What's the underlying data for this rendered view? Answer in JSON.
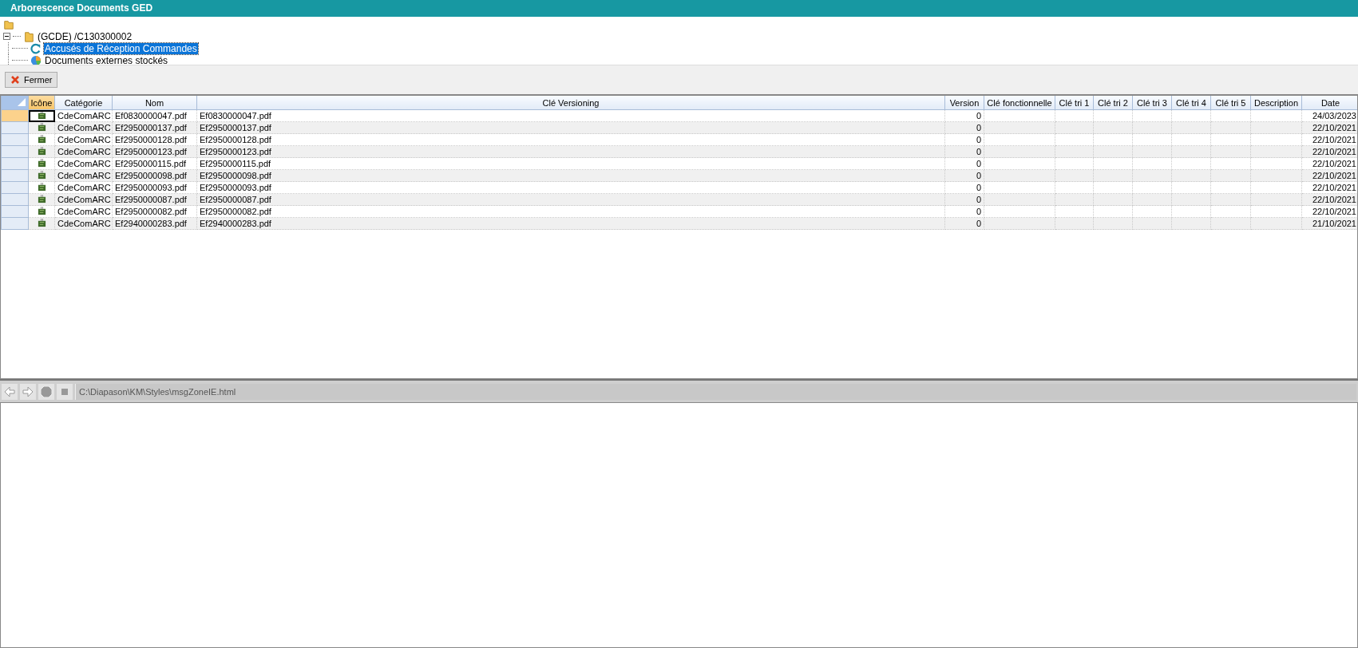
{
  "window": {
    "title": "Arborescence Documents GED"
  },
  "tree": {
    "root": {
      "children": [
        {
          "label": "(GCDE) /C130300002",
          "expanded": true,
          "children": [
            {
              "label": "Accusés de Réception Commandes",
              "kind": "refresh",
              "selected": true
            },
            {
              "label": "Documents externes stockés",
              "kind": "chart",
              "selected": false
            }
          ]
        }
      ]
    }
  },
  "toolbar": {
    "close_button": "Fermer"
  },
  "table": {
    "columns": [
      {
        "label": "Icône",
        "selected": true
      },
      {
        "label": "Catégorie",
        "selected": false
      },
      {
        "label": "Nom",
        "selected": false
      },
      {
        "label": "Clé Versioning",
        "selected": false
      },
      {
        "label": "Version",
        "selected": false
      },
      {
        "label": "Clé fonctionnelle",
        "selected": false
      },
      {
        "label": "Clé tri 1",
        "selected": false
      },
      {
        "label": "Clé tri 2",
        "selected": false
      },
      {
        "label": "Clé tri 3",
        "selected": false
      },
      {
        "label": "Clé tri 4",
        "selected": false
      },
      {
        "label": "Clé tri 5",
        "selected": false
      },
      {
        "label": "Description",
        "selected": false
      },
      {
        "label": "Date",
        "selected": false
      }
    ],
    "rows": [
      {
        "selected": true,
        "categorie": "CdeComARC",
        "nom": "Ef0830000047.pdf",
        "cle_versioning": "Ef0830000047.pdf",
        "version": "0",
        "date": "24/03/2023"
      },
      {
        "selected": false,
        "categorie": "CdeComARC",
        "nom": "Ef2950000137.pdf",
        "cle_versioning": "Ef2950000137.pdf",
        "version": "0",
        "date": "22/10/2021"
      },
      {
        "selected": false,
        "categorie": "CdeComARC",
        "nom": "Ef2950000128.pdf",
        "cle_versioning": "Ef2950000128.pdf",
        "version": "0",
        "date": "22/10/2021"
      },
      {
        "selected": false,
        "categorie": "CdeComARC",
        "nom": "Ef2950000123.pdf",
        "cle_versioning": "Ef2950000123.pdf",
        "version": "0",
        "date": "22/10/2021"
      },
      {
        "selected": false,
        "categorie": "CdeComARC",
        "nom": "Ef2950000115.pdf",
        "cle_versioning": "Ef2950000115.pdf",
        "version": "0",
        "date": "22/10/2021"
      },
      {
        "selected": false,
        "categorie": "CdeComARC",
        "nom": "Ef2950000098.pdf",
        "cle_versioning": "Ef2950000098.pdf",
        "version": "0",
        "date": "22/10/2021"
      },
      {
        "selected": false,
        "categorie": "CdeComARC",
        "nom": "Ef2950000093.pdf",
        "cle_versioning": "Ef2950000093.pdf",
        "version": "0",
        "date": "22/10/2021"
      },
      {
        "selected": false,
        "categorie": "CdeComARC",
        "nom": "Ef2950000087.pdf",
        "cle_versioning": "Ef2950000087.pdf",
        "version": "0",
        "date": "22/10/2021"
      },
      {
        "selected": false,
        "categorie": "CdeComARC",
        "nom": "Ef2950000082.pdf",
        "cle_versioning": "Ef2950000082.pdf",
        "version": "0",
        "date": "22/10/2021"
      },
      {
        "selected": false,
        "categorie": "CdeComARC",
        "nom": "Ef2940000283.pdf",
        "cle_versioning": "Ef2940000283.pdf",
        "version": "0",
        "date": "21/10/2021"
      }
    ]
  },
  "browser": {
    "address": "C:\\Diapason\\KM\\Styles\\msgZoneIE.html"
  }
}
